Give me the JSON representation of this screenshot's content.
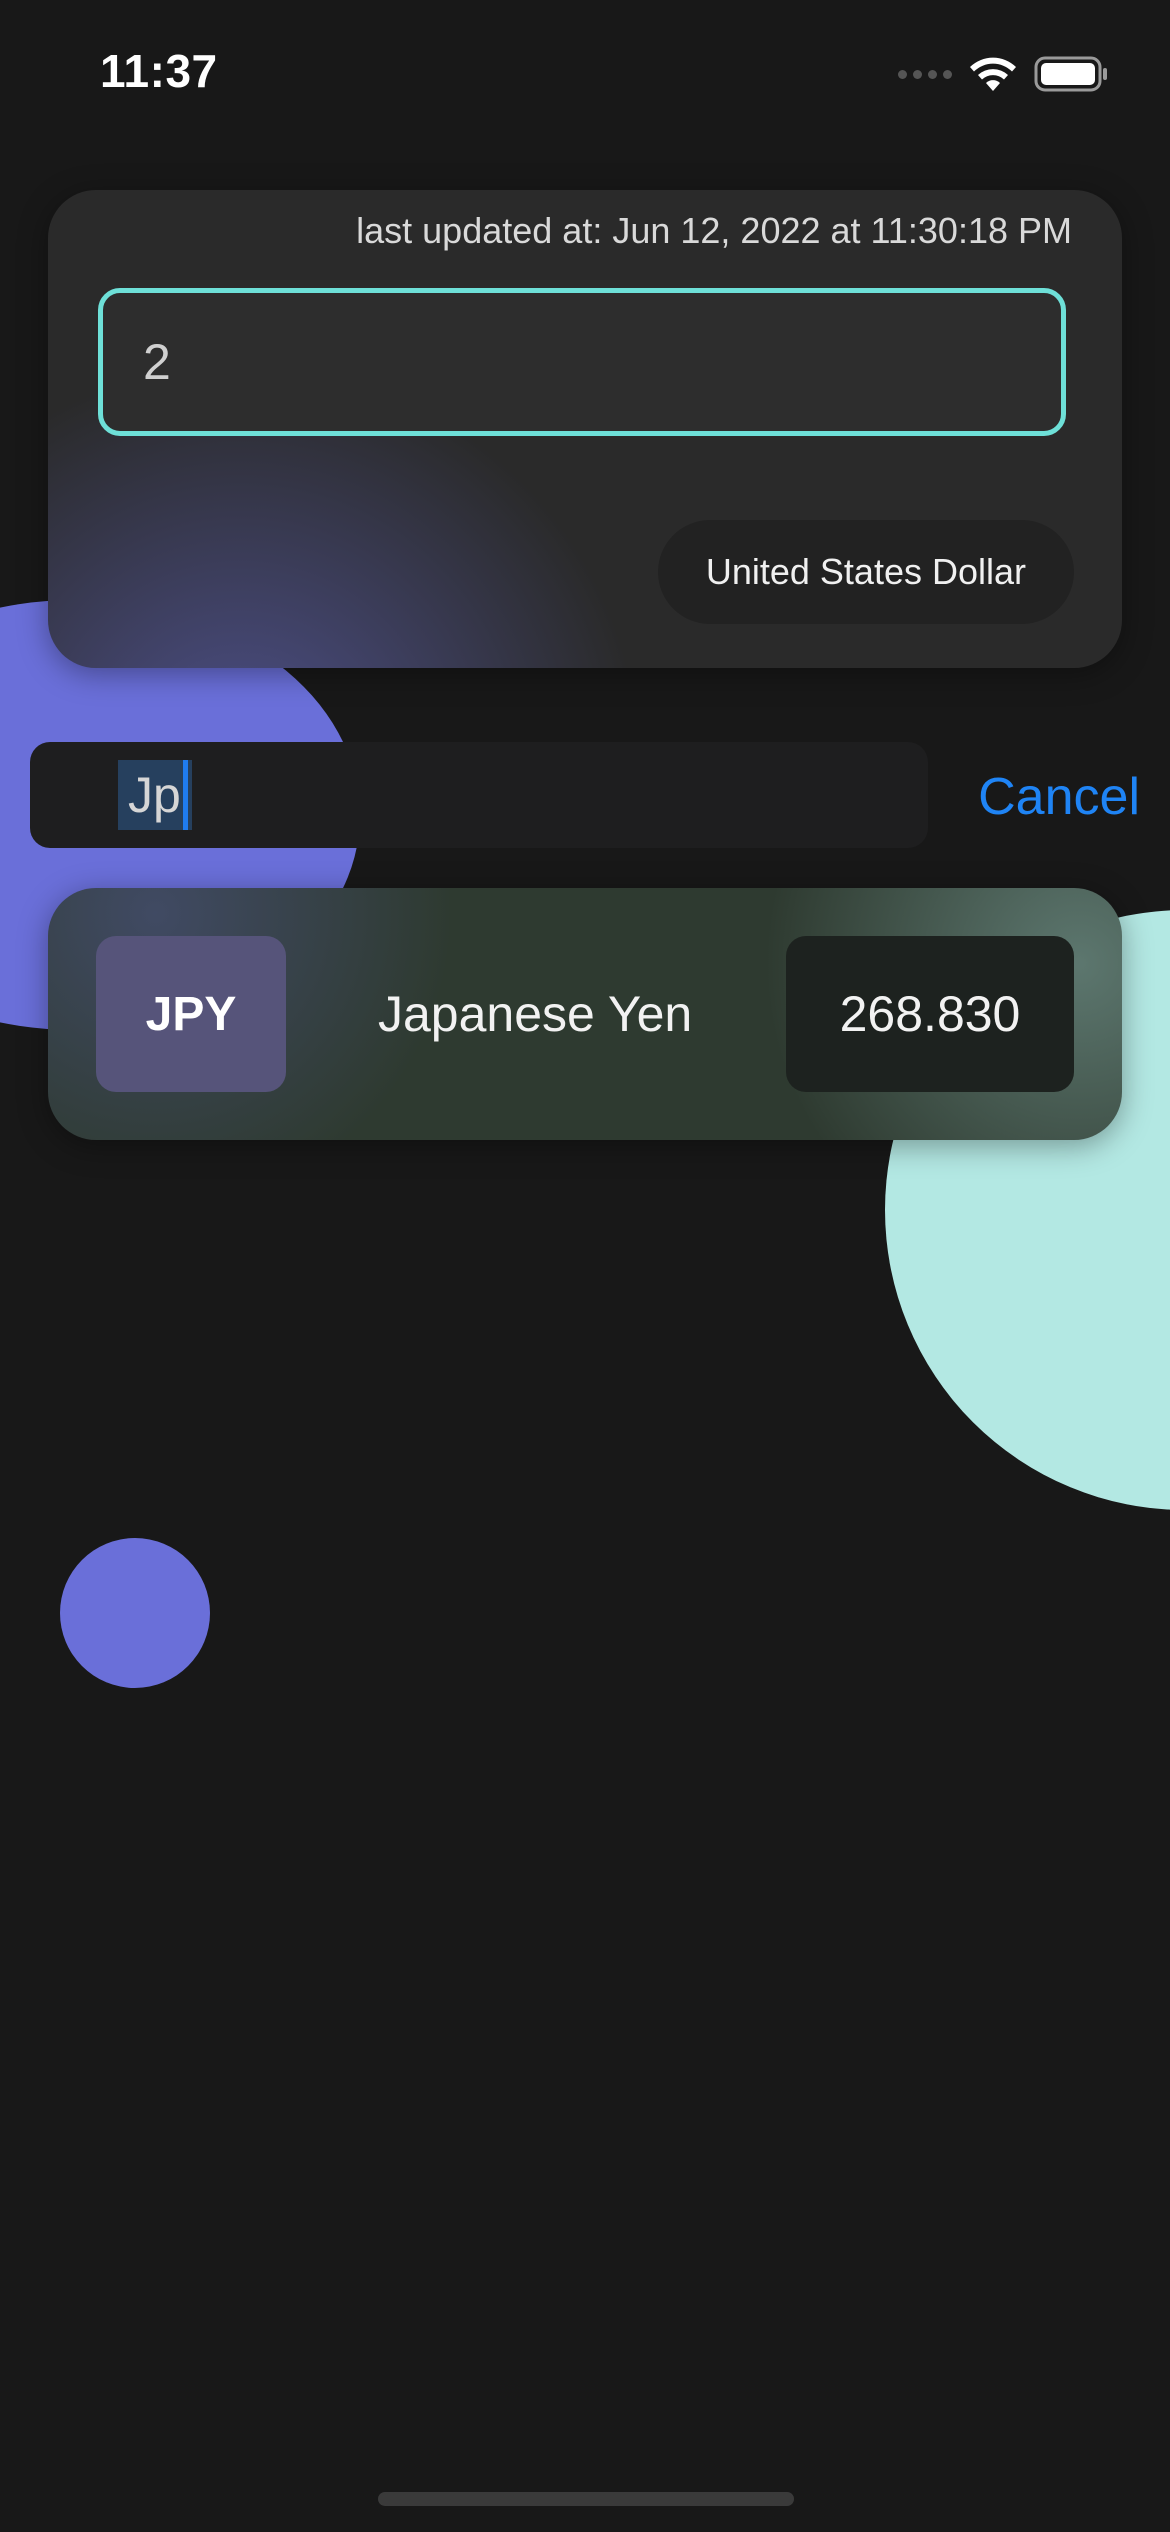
{
  "status_bar": {
    "time": "11:37",
    "icons": [
      "signal-icon",
      "wifi-icon",
      "battery-icon"
    ]
  },
  "converter": {
    "last_updated": "last updated at: Jun 12, 2022 at 11:30:18 PM",
    "amount_value": "2",
    "base_currency": "United States Dollar",
    "accent_color": "#6ee0d8"
  },
  "search": {
    "query": "Jp",
    "cancel_label": "Cancel",
    "cancel_color": "#1f84f5"
  },
  "results": [
    {
      "code": "JPY",
      "name": "Japanese Yen",
      "rate": "268.830"
    }
  ],
  "colors": {
    "background": "#181818",
    "purple_blob": "#6a6fd9",
    "teal_blob": "#b3e8e3"
  }
}
